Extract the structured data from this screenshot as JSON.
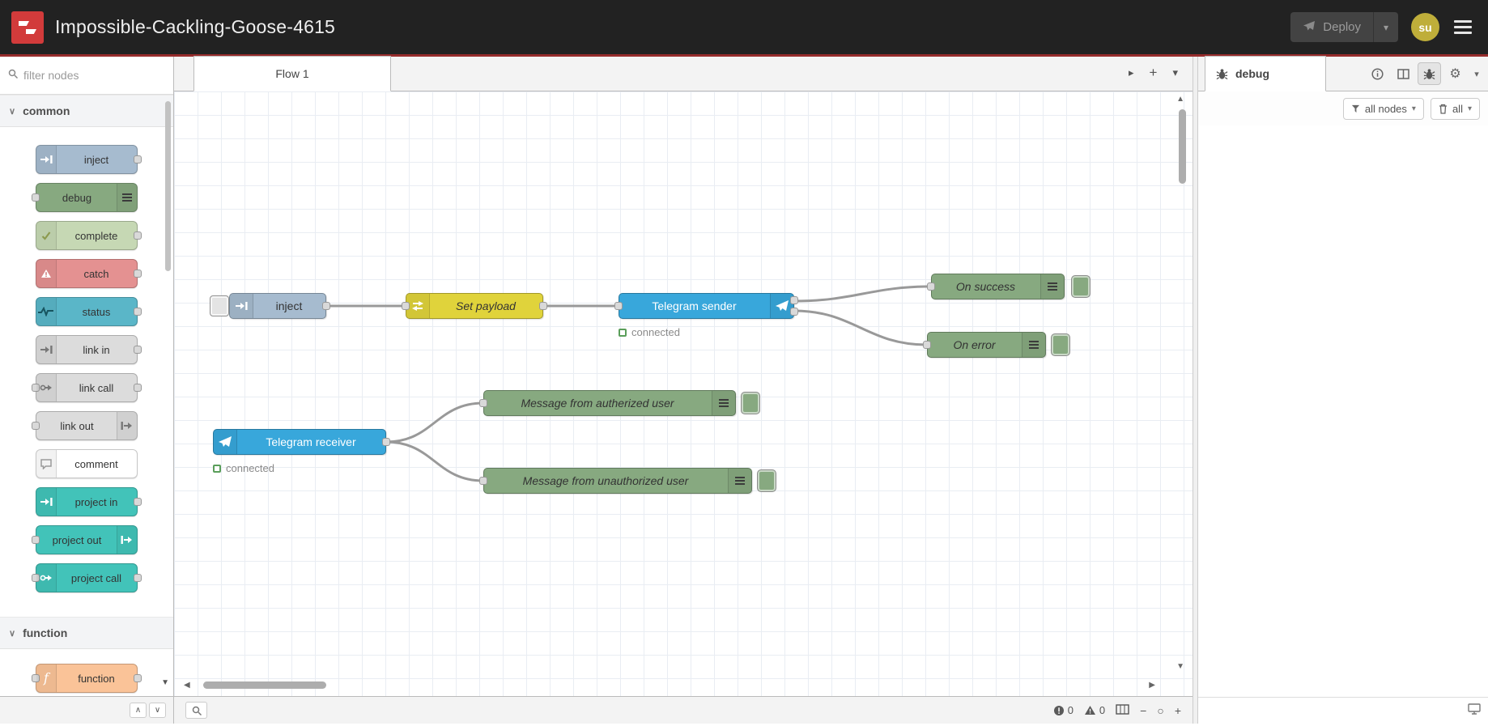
{
  "icons": {
    "chevron_down": "▾",
    "chevron_small": "∨",
    "collapse_all": "∧",
    "expand_all": "∨",
    "tab_scroll_right": "▸",
    "add_flow": "+",
    "zoom_out": "−",
    "zoom_reset": "○",
    "zoom_in": "+",
    "gear": "⚙",
    "scroll_up": "▲",
    "scroll_down": "▼",
    "scroll_left": "◀",
    "scroll_right": "▶"
  },
  "header": {
    "title": "Impossible-Cackling-Goose-4615",
    "deploy_label": "Deploy",
    "user_initials": "su"
  },
  "palette": {
    "filter_placeholder": "filter nodes",
    "category_common": "common",
    "category_function": "function",
    "common": [
      "inject",
      "debug",
      "complete",
      "catch",
      "status",
      "link in",
      "link call",
      "link out",
      "comment",
      "project in",
      "project out",
      "project call"
    ],
    "function_nodes": [
      "function"
    ]
  },
  "flow": {
    "tab_label": "Flow 1",
    "nodes": {
      "inject": "inject",
      "set_payload": "Set payload",
      "telegram_sender": "Telegram sender",
      "on_success": "On success",
      "on_error": "On error",
      "telegram_receiver": "Telegram receiver",
      "msg_authorized": "Message from autherized user",
      "msg_unauthorized": "Message from unauthorized user"
    },
    "status": {
      "sender": "connected",
      "receiver": "connected"
    }
  },
  "sidebar": {
    "tab_label": "debug",
    "filter_label": "all nodes",
    "clear_label": "all"
  },
  "statusbar": {
    "errors": "0",
    "warnings": "0"
  }
}
